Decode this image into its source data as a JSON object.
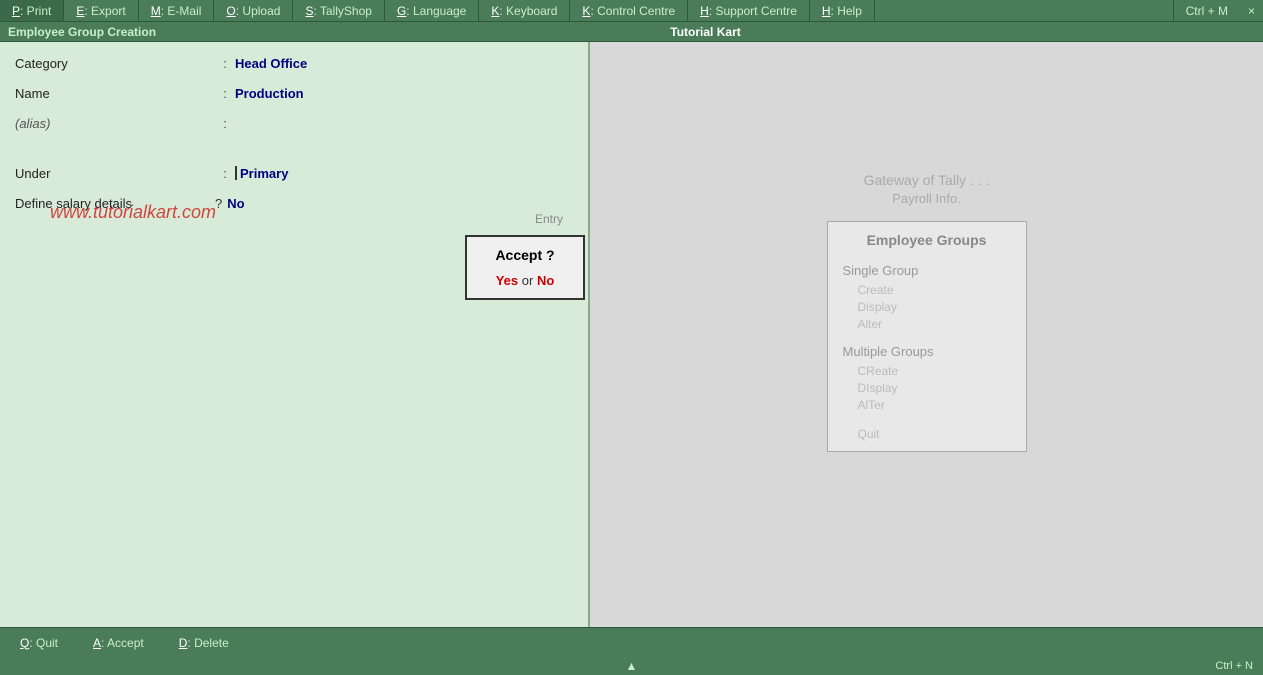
{
  "topMenu": {
    "items": [
      {
        "id": "print",
        "key": "P",
        "label": ": Print"
      },
      {
        "id": "export",
        "key": "E",
        "label": ": Export"
      },
      {
        "id": "email",
        "key": "M",
        "label": ": E-Mail"
      },
      {
        "id": "upload",
        "key": "O",
        "label": ": Upload"
      },
      {
        "id": "tallyshop",
        "key": "S",
        "label": ": TallyShop"
      },
      {
        "id": "language",
        "key": "G",
        "label": ": Language"
      },
      {
        "id": "keyboard",
        "key": "K",
        "label": ": Keyboard"
      },
      {
        "id": "control",
        "key": "K",
        "label": ": Control Centre"
      },
      {
        "id": "support",
        "key": "H",
        "label": ": Support Centre"
      },
      {
        "id": "help",
        "key": "H",
        "label": ": Help"
      }
    ],
    "ctrlM": "Ctrl + M",
    "closeBtn": "×"
  },
  "titleBar": {
    "left": "Employee Group  Creation",
    "center": "Tutorial Kart",
    "right": ""
  },
  "form": {
    "categoryLabel": "Category",
    "categoryValue": "Head Office",
    "nameLabel": "Name",
    "nameValue": "Production",
    "aliasLabel": "(alias)",
    "aliasValue": "",
    "underLabel": "Under",
    "underValue": "Primary",
    "defineSalaryLabel": "Define salary details",
    "defineSalaryValue": "No",
    "watermark": "www.tutorialkart.com",
    "entryHint": "Entry"
  },
  "acceptDialog": {
    "title": "Accept ?",
    "yesText": "Yes",
    "orText": " or ",
    "noText": "No"
  },
  "rightPanel": {
    "gatewayText": "Gateway of Tally . . .",
    "payrollText": "Payroll Info.",
    "empGroupsTitle": "Employee Groups",
    "singleGroupTitle": "Single Group",
    "singleGroupItems": [
      "Create",
      "Display",
      "Alter"
    ],
    "multipleGroupTitle": "Multiple Groups",
    "multipleGroupItems": [
      "CReate",
      "DIsplay",
      "AlTer"
    ],
    "quitItem": "Quit"
  },
  "bottomBar": {
    "quitKey": "Q",
    "quitLabel": ": Quit",
    "acceptKey": "A",
    "acceptLabel": ": Accept",
    "deleteKey": "D",
    "deleteLabel": ": Delete"
  },
  "scrollArrow": "▲",
  "ctrlNHint": "Ctrl + N"
}
